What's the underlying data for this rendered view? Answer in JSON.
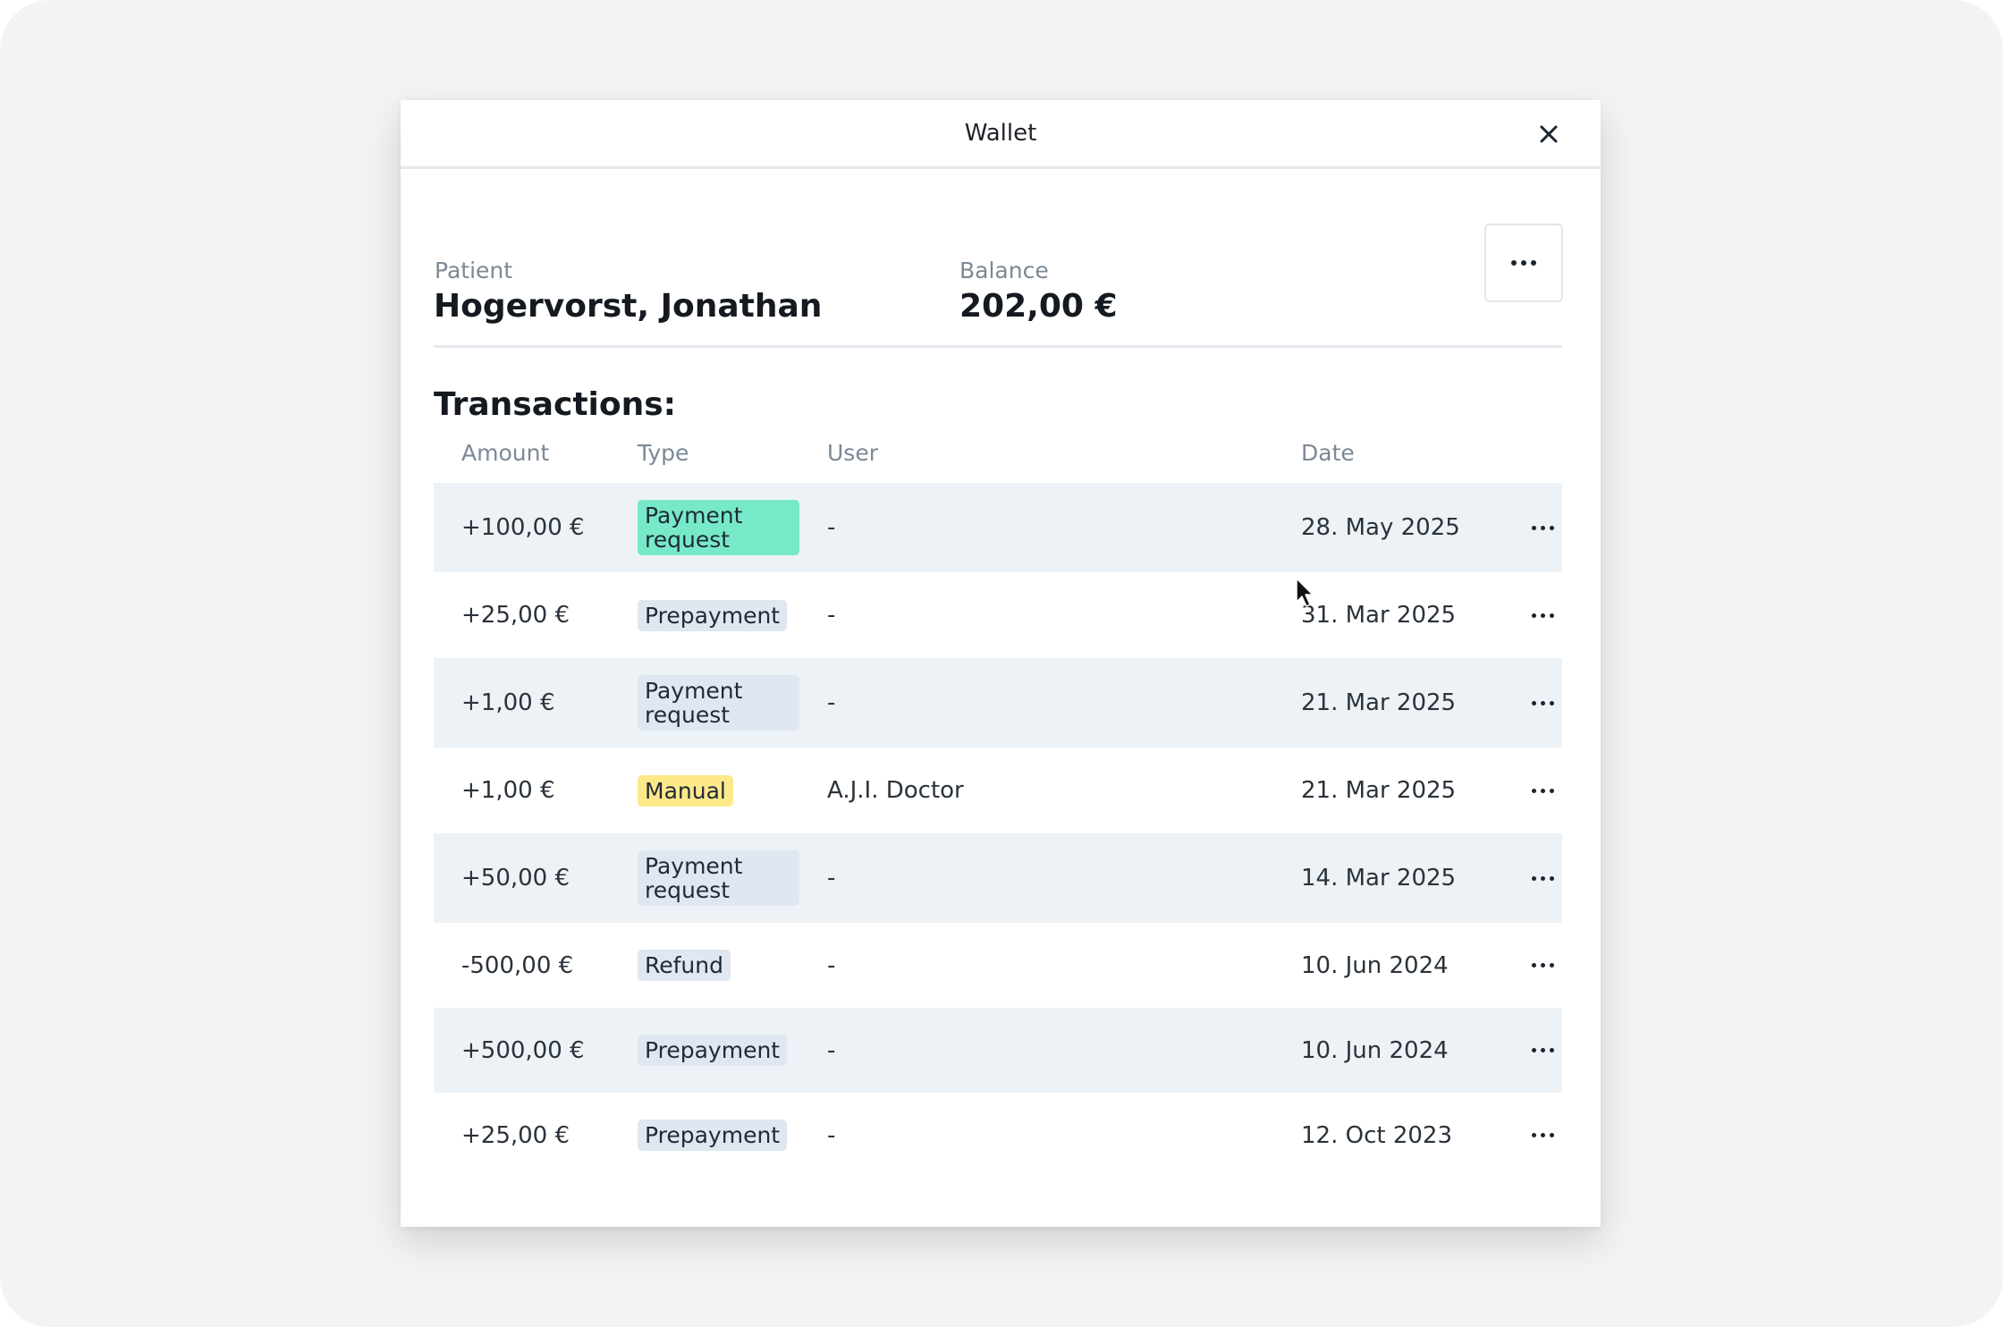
{
  "dialog": {
    "title": "Wallet",
    "close_label": "close"
  },
  "summary": {
    "patient_label": "Patient",
    "patient_name": "Hogervorst, Jonathan",
    "balance_label": "Balance",
    "balance_value": "202,00 €"
  },
  "transactions": {
    "title": "Transactions:",
    "columns": {
      "amount": "Amount",
      "type": "Type",
      "user": "User",
      "date": "Date"
    },
    "rows": [
      {
        "amount": "+100,00 €",
        "type": "Payment request",
        "type_color": "#77e9c8",
        "user": "-",
        "date": "28. May 2025"
      },
      {
        "amount": "+25,00 €",
        "type": "Prepayment",
        "type_color": "#dfe7f0",
        "user": "-",
        "date": "31. Mar 2025"
      },
      {
        "amount": "+1,00 €",
        "type": "Payment request",
        "type_color": "#dfe7f0",
        "user": "-",
        "date": "21. Mar 2025"
      },
      {
        "amount": "+1,00 €",
        "type": "Manual",
        "type_color": "#fde98a",
        "user": "A.J.I. Doctor",
        "date": "21. Mar 2025"
      },
      {
        "amount": "+50,00 €",
        "type": "Payment request",
        "type_color": "#dfe7f0",
        "user": "-",
        "date": "14. Mar 2025"
      },
      {
        "amount": "-500,00 €",
        "type": "Refund",
        "type_color": "#dfe7f0",
        "user": "-",
        "date": "10. Jun 2024"
      },
      {
        "amount": "+500,00 €",
        "type": "Prepayment",
        "type_color": "#dfe7f0",
        "user": "-",
        "date": "10. Jun 2024"
      },
      {
        "amount": "+25,00 €",
        "type": "Prepayment",
        "type_color": "#dfe7f0",
        "user": "-",
        "date": "12. Oct 2023"
      }
    ]
  },
  "icons": {
    "close": "close-icon",
    "more": "more-horizontal-icon",
    "cursor": "mouse-pointer-icon"
  }
}
